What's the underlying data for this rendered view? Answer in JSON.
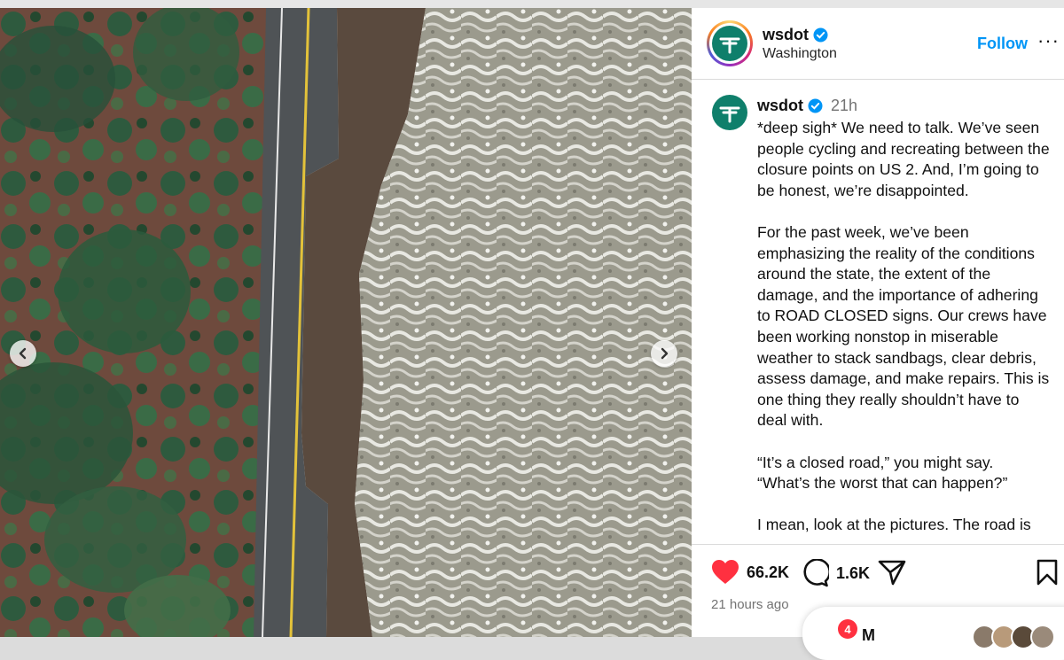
{
  "post": {
    "username": "wsdot",
    "location": "Washington",
    "follow_label": "Follow",
    "more_label": "···"
  },
  "caption": {
    "username": "wsdot",
    "time_ago": "21h",
    "paragraphs": [
      "*deep sigh* We need to talk. We’ve seen people cycling and recreating between the closure points on US 2. And, I’m going to be honest, we’re disappointed.",
      "For the past week, we’ve been emphasizing the reality of the conditions around the state, the extent of the damage, and the importance of adhering to ROAD CLOSED signs. Our crews have been working nonstop in miserable weather to stack sandbags, clear debris, assess damage, and make repairs. This is one thing they really shouldn’t have to deal with.",
      "“It’s a closed road,” you might say. “What’s the worst that can happen?”",
      "I mean, look at the pictures. The road is"
    ]
  },
  "stats": {
    "likes": "66.2K",
    "comments": "1.6K",
    "timestamp": "21 hours ago"
  },
  "messages": {
    "badge_count": "4",
    "label": "M"
  },
  "icons": {
    "verified": "verified-badge-icon",
    "like": "heart-icon",
    "comment": "comment-icon",
    "share": "share-icon",
    "save": "bookmark-icon",
    "prev": "chevron-left-icon",
    "next": "chevron-right-icon"
  },
  "colors": {
    "accent": "#0095f6",
    "like": "#ff3040",
    "brand": "#0f7f6b"
  }
}
